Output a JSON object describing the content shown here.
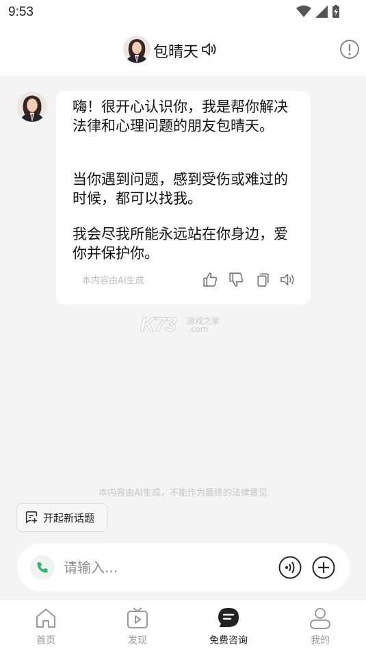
{
  "status_bar": {
    "time": "9:53"
  },
  "header": {
    "title": "包晴天"
  },
  "chat": {
    "messages": [
      "嗨！很开心认识你，我是帮你解决法律和心理问题的朋友包晴天。",
      "当你遇到问题，感到受伤或难过的时候，都可以找我。",
      "我会尽我所能永远站在你身边，爱你并保护你。"
    ],
    "ai_note": "本内容由AI生成"
  },
  "watermark": {
    "brand": "K73",
    "sub1": "游戏之家",
    "sub2": ".com"
  },
  "disclaimer": "本内容由AI生成，不能作为最终的法律意见",
  "new_topic": {
    "label": "开起新话题"
  },
  "input": {
    "placeholder": "请输入..."
  },
  "tabs": [
    {
      "label": "首页",
      "icon": "home-icon",
      "active": false
    },
    {
      "label": "发现",
      "icon": "tv-icon",
      "active": false
    },
    {
      "label": "免费咨询",
      "icon": "chat-icon",
      "active": true
    },
    {
      "label": "我的",
      "icon": "user-icon",
      "active": false
    }
  ],
  "colors": {
    "accent_green": "#2fb36a",
    "active_tab": "#222222",
    "inactive_tab": "#9a9a9a",
    "background": "#f4f4f4"
  }
}
